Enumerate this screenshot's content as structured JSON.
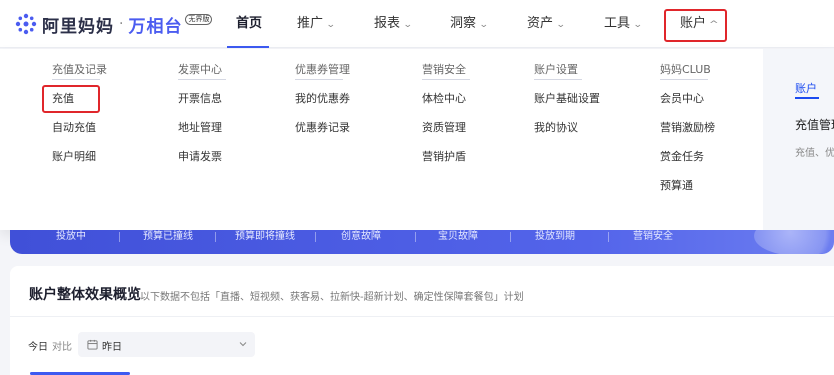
{
  "header": {
    "logo_text": "阿里妈妈",
    "logo_dot": "·",
    "logo_sub": "万相台",
    "logo_badge": "无界版",
    "nav": [
      {
        "label": "首页",
        "active": true
      },
      {
        "label": "推广",
        "chevron": "chevron-down"
      },
      {
        "label": "报表",
        "chevron": "chevron-down"
      },
      {
        "label": "洞察",
        "chevron": "chevron-down"
      },
      {
        "label": "资产",
        "chevron": "chevron-down"
      },
      {
        "label": "工具",
        "chevron": "chevron-down"
      },
      {
        "label": "账户",
        "chevron": "chevron-up",
        "open": true
      }
    ],
    "chevron_down": "⌄",
    "chevron_up": "^"
  },
  "dropdown": {
    "columns": [
      {
        "title": "充值及记录",
        "items": [
          "充值",
          "自动充值",
          "账户明细"
        ]
      },
      {
        "title": "发票中心",
        "items": [
          "开票信息",
          "地址管理",
          "申请发票"
        ]
      },
      {
        "title": "优惠券管理",
        "items": [
          "我的优惠券",
          "优惠券记录"
        ]
      },
      {
        "title": "营销安全",
        "items": [
          "体检中心",
          "资质管理",
          "营销护盾"
        ]
      },
      {
        "title": "账户设置",
        "items": [
          "账户基础设置",
          "我的协议"
        ]
      },
      {
        "title": "妈妈CLUB",
        "items": [
          "会员中心",
          "营销激励榜",
          "赏金任务",
          "预算通"
        ]
      }
    ],
    "side_panel": {
      "tab": "账户",
      "heading": "充值管理",
      "desc": "充值、优"
    }
  },
  "banner": {
    "items": [
      "投放中",
      "预算已撞线",
      "预算即将撞线",
      "创意故障",
      "宝贝故障",
      "投放到期",
      "营销安全"
    ]
  },
  "overview": {
    "title": "账户整体效果概览",
    "note": "以下数据不包括「直播、短视频、获客易、拉新快-超新计划、确定性保障套餐包」计划",
    "today_label": "今日",
    "compare_label": "对比",
    "date_value": "昨日"
  },
  "colors": {
    "accent": "#3d5af1",
    "highlight": "#e0262b",
    "banner": "#4a5ae0"
  }
}
